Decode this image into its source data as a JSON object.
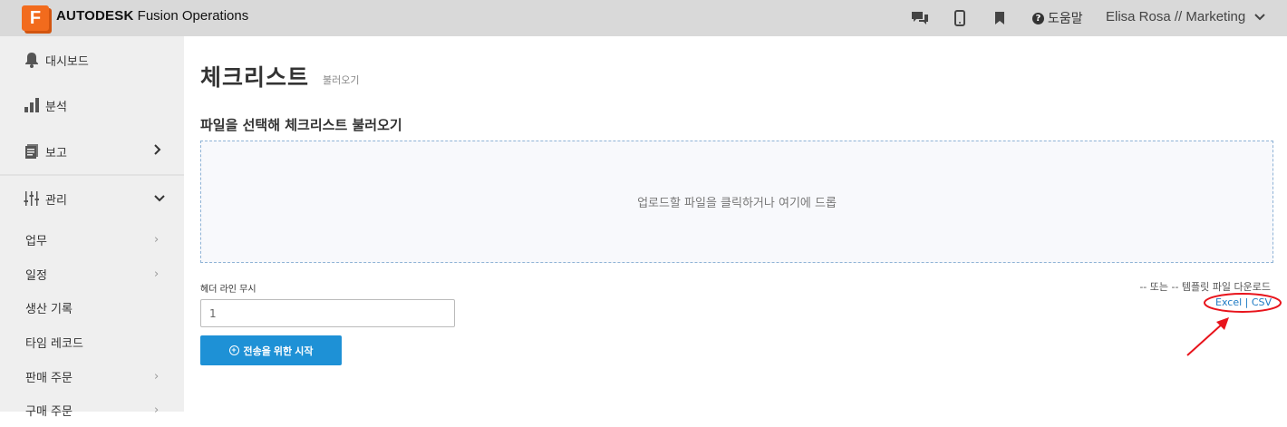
{
  "header": {
    "logo_letter": "F",
    "brand_bold": "AUTODESK",
    "brand_rest": "Fusion Operations",
    "help_label": "도움말",
    "user_label": "Elisa Rosa // Marketing",
    "icons": [
      "chat-icon",
      "mobile-icon",
      "bookmark-icon",
      "help-icon",
      "chevron-down-icon"
    ]
  },
  "sidebar": {
    "main_items": [
      {
        "label": "대시보드",
        "icon": "bell-icon"
      },
      {
        "label": "분석",
        "icon": "bar-chart-icon"
      },
      {
        "label": "보고",
        "icon": "report-icon",
        "chevron": "›"
      },
      {
        "label": "관리",
        "icon": "sliders-icon",
        "chevron": "⌄"
      }
    ],
    "sub_items": [
      {
        "label": "업무",
        "chevron": "›"
      },
      {
        "label": "일정",
        "chevron": "›"
      },
      {
        "label": "생산 기록"
      },
      {
        "label": "타임 레코드"
      },
      {
        "label": "판매 주문",
        "chevron": "›"
      },
      {
        "label": "구매 주문",
        "chevron": "›"
      }
    ]
  },
  "main": {
    "title": "체크리스트",
    "subtitle": "불러오기",
    "section_title": "파일을 선택해 체크리스트 불러오기",
    "dropzone_text": "업로드할 파일을 클릭하거나 여기에 드롭",
    "header_ignore_label": "헤더 라인 무시",
    "header_ignore_value": "1",
    "start_button": "전송을 위한 시작",
    "template_text": "-- 또는 -- 템플릿 파일 다운로드",
    "link_excel": "Excel",
    "link_sep": " | ",
    "link_csv": "CSV"
  },
  "colors": {
    "brand_orange": "#f26b1d",
    "primary_blue": "#1e91d6",
    "annotation_red": "#e8141c"
  }
}
